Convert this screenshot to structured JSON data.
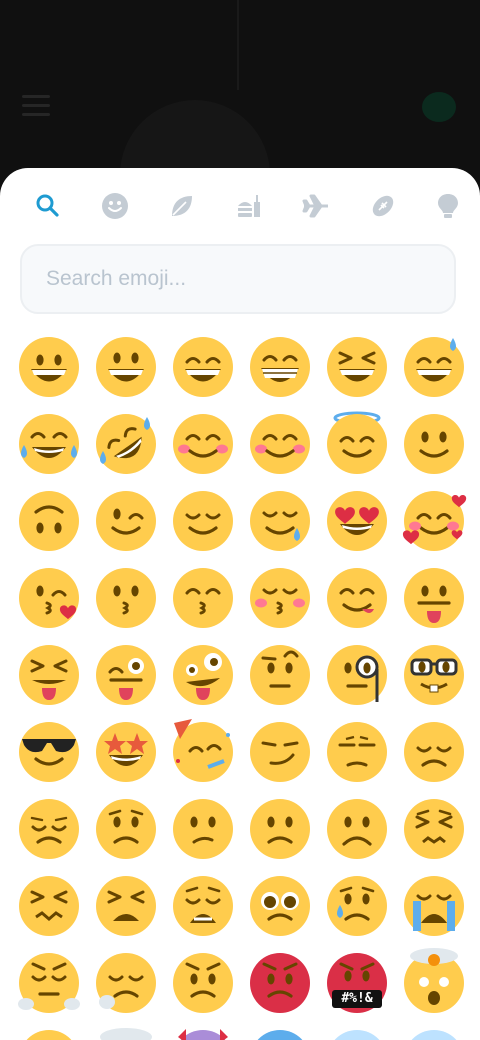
{
  "search": {
    "placeholder": "Search emoji..."
  },
  "tabs": [
    {
      "icon": "search-icon",
      "active": true
    },
    {
      "icon": "smiley-icon"
    },
    {
      "icon": "leaf-icon"
    },
    {
      "icon": "food-icon"
    },
    {
      "icon": "airplane-icon"
    },
    {
      "icon": "football-icon"
    },
    {
      "icon": "lightbulb-icon"
    }
  ],
  "colors": {
    "accent": "#1e9bd1",
    "tab_inactive": "#c4ccd4",
    "emoji_face": "#ffcc4d",
    "emoji_feature": "#664500",
    "blush": "#ff7892",
    "tear": "#5dadec",
    "heart": "#dd2e44",
    "angry_face": "#da2f47"
  },
  "emoji_rows": [
    [
      "grinning-face",
      "smiling-face-with-open-mouth",
      "grinning-face-with-smiling-eyes",
      "beaming-face",
      "grinning-squinting-face",
      "grinning-face-with-sweat"
    ],
    [
      "face-with-tears-of-joy",
      "rolling-on-floor-laughing",
      "smiling-face-with-smiling-eyes",
      "smiling-face-blushing",
      "smiling-face-with-halo",
      "slightly-smiling-face"
    ],
    [
      "upside-down-face",
      "winking-face",
      "relieved-face",
      "smiling-face-with-tear",
      "smiling-face-with-heart-eyes",
      "smiling-face-with-hearts"
    ],
    [
      "face-blowing-kiss",
      "kissing-face",
      "kissing-face-with-smiling-eyes",
      "kissing-face-with-closed-eyes",
      "face-savoring-food",
      "face-with-tongue"
    ],
    [
      "squinting-face-with-tongue",
      "winking-face-with-tongue",
      "zany-face",
      "face-with-raised-eyebrow",
      "face-with-monocle",
      "nerd-face"
    ],
    [
      "smiling-face-with-sunglasses",
      "star-struck",
      "partying-face",
      "smirking-face",
      "unamused-face",
      "disappointed-face"
    ],
    [
      "pensive-face",
      "worried-face",
      "confused-face",
      "slightly-frowning-face",
      "frowning-face",
      "persevering-face"
    ],
    [
      "confounded-face",
      "tired-face",
      "weary-face",
      "pleading-face",
      "crying-face",
      "loudly-crying-face"
    ],
    [
      "face-with-steam",
      "sleepy-face",
      "angry-face",
      "pouting-face",
      "face-with-symbols-on-mouth",
      "exploding-head"
    ],
    [
      "smiling-face-with-open-mouth-partial",
      "face-in-clouds",
      "smiling-face-with-horns",
      "cold-face",
      "face-with-sweat",
      "anxious-face"
    ]
  ],
  "symbols_label": "#%!&"
}
